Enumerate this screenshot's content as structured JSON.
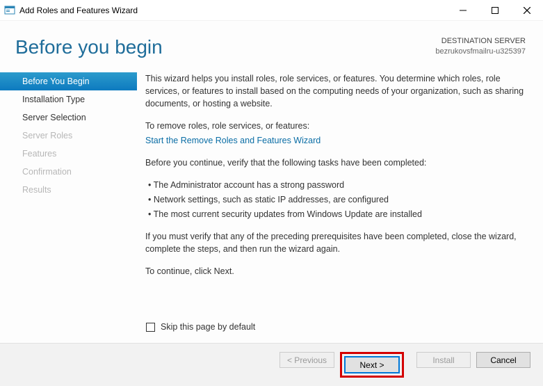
{
  "window": {
    "title": "Add Roles and Features Wizard"
  },
  "header": {
    "heading": "Before you begin",
    "destination_label": "DESTINATION SERVER",
    "destination_value": "bezrukovsfmailru-u325397"
  },
  "sidebar": {
    "items": [
      {
        "label": "Before You Begin",
        "state": "active"
      },
      {
        "label": "Installation Type",
        "state": "enabled"
      },
      {
        "label": "Server Selection",
        "state": "enabled"
      },
      {
        "label": "Server Roles",
        "state": "disabled"
      },
      {
        "label": "Features",
        "state": "disabled"
      },
      {
        "label": "Confirmation",
        "state": "disabled"
      },
      {
        "label": "Results",
        "state": "disabled"
      }
    ]
  },
  "content": {
    "intro": "This wizard helps you install roles, role services, or features. You determine which roles, role services, or features to install based on the computing needs of your organization, such as sharing documents, or hosting a website.",
    "remove_label": "To remove roles, role services, or features:",
    "remove_link": "Start the Remove Roles and Features Wizard",
    "verify_label": "Before you continue, verify that the following tasks have been completed:",
    "bullets": [
      "The Administrator account has a strong password",
      "Network settings, such as static IP addresses, are configured",
      "The most current security updates from Windows Update are installed"
    ],
    "verify_note": "If you must verify that any of the preceding prerequisites have been completed, close the wizard, complete the steps, and then run the wizard again.",
    "continue_note": "To continue, click Next.",
    "skip_label": "Skip this page by default",
    "skip_checked": false
  },
  "footer": {
    "previous": "< Previous",
    "next": "Next >",
    "install": "Install",
    "cancel": "Cancel"
  }
}
